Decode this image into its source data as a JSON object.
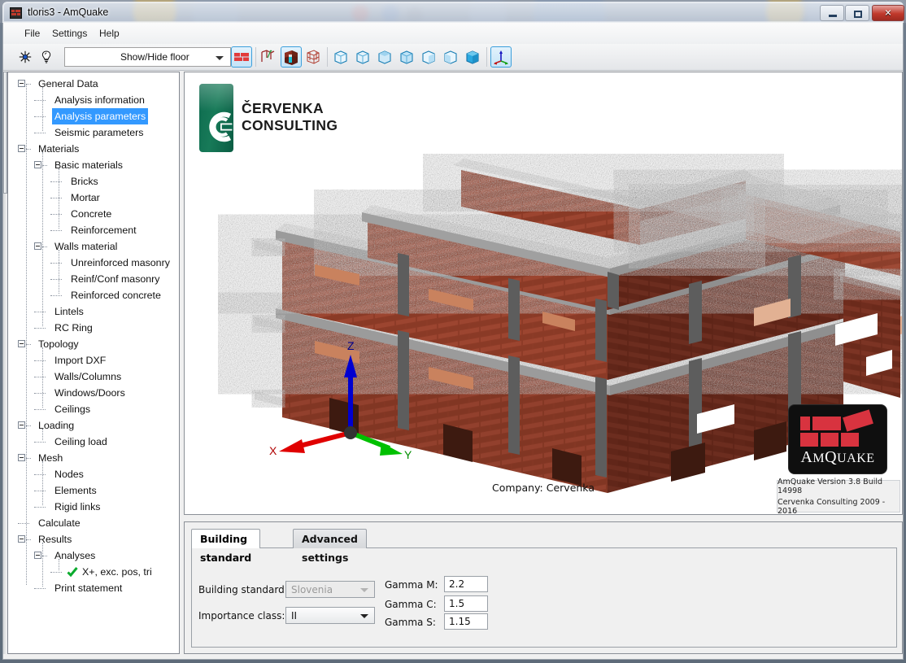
{
  "window": {
    "title": "tloris3 - AmQuake",
    "icon": "amquake-brick-icon",
    "minimize": "Minimize",
    "maximize": "Maximize",
    "close": "Close"
  },
  "menu": {
    "items": [
      {
        "label": "File",
        "name": "menu-file"
      },
      {
        "label": "Settings",
        "name": "menu-settings"
      },
      {
        "label": "Help",
        "name": "menu-help"
      }
    ]
  },
  "toolbar": {
    "sun_icon": "sun-light-icon",
    "bulb_icon": "lightbulb-icon",
    "floor_combo": {
      "value": "Show/Hide floor",
      "arrow": "chevron-down-icon"
    },
    "buttons": [
      {
        "name": "show-walls-button",
        "icon": "brick-wall-icon",
        "active": true
      },
      {
        "name": "show-graph-button",
        "icon": "graph-icon",
        "active": false
      },
      {
        "name": "show-solid-model-button",
        "icon": "solid-cube-icon",
        "active": true
      },
      {
        "name": "show-wireframe-button",
        "icon": "wireframe-cube-icon",
        "active": false
      },
      {
        "name": "view-front-button",
        "icon": "cube-view-1-icon",
        "active": false
      },
      {
        "name": "view-back-button",
        "icon": "cube-view-2-icon",
        "active": false
      },
      {
        "name": "view-top-button",
        "icon": "cube-view-3-icon",
        "active": false
      },
      {
        "name": "view-bottom-button",
        "icon": "cube-view-4-icon",
        "active": false
      },
      {
        "name": "view-left-button",
        "icon": "cube-view-5-icon",
        "active": false
      },
      {
        "name": "view-right-button",
        "icon": "cube-view-6-icon",
        "active": false
      },
      {
        "name": "view-iso-button",
        "icon": "cube-iso-filled-icon",
        "active": false
      },
      {
        "name": "axis-orientation-button",
        "icon": "axis-triad-icon",
        "active": false
      }
    ]
  },
  "tree": {
    "selected": "Analysis parameters",
    "items": [
      {
        "label": "General Data",
        "depth": 0,
        "expander": true,
        "name": "tree-item-general-data"
      },
      {
        "label": "Analysis information",
        "depth": 1,
        "expander": false,
        "name": "tree-item-analysis-information"
      },
      {
        "label": "Analysis parameters",
        "depth": 1,
        "expander": false,
        "name": "tree-item-analysis-parameters",
        "selected": true
      },
      {
        "label": "Seismic parameters",
        "depth": 1,
        "expander": false,
        "name": "tree-item-seismic-parameters"
      },
      {
        "label": "Materials",
        "depth": 0,
        "expander": true,
        "name": "tree-item-materials"
      },
      {
        "label": "Basic materials",
        "depth": 1,
        "expander": true,
        "name": "tree-item-basic-materials"
      },
      {
        "label": "Bricks",
        "depth": 2,
        "expander": false,
        "name": "tree-item-bricks"
      },
      {
        "label": "Mortar",
        "depth": 2,
        "expander": false,
        "name": "tree-item-mortar"
      },
      {
        "label": "Concrete",
        "depth": 2,
        "expander": false,
        "name": "tree-item-concrete"
      },
      {
        "label": "Reinforcement",
        "depth": 2,
        "expander": false,
        "name": "tree-item-reinforcement"
      },
      {
        "label": "Walls material",
        "depth": 1,
        "expander": true,
        "name": "tree-item-walls-material"
      },
      {
        "label": "Unreinforced masonry",
        "depth": 2,
        "expander": false,
        "name": "tree-item-unreinforced-masonry"
      },
      {
        "label": "Reinf/Conf masonry",
        "depth": 2,
        "expander": false,
        "name": "tree-item-reinf-conf-masonry"
      },
      {
        "label": "Reinforced concrete",
        "depth": 2,
        "expander": false,
        "name": "tree-item-reinforced-concrete"
      },
      {
        "label": "Lintels",
        "depth": 1,
        "expander": false,
        "name": "tree-item-lintels"
      },
      {
        "label": "RC Ring",
        "depth": 1,
        "expander": false,
        "name": "tree-item-rc-ring"
      },
      {
        "label": "Topology",
        "depth": 0,
        "expander": true,
        "name": "tree-item-topology"
      },
      {
        "label": "Import DXF",
        "depth": 1,
        "expander": false,
        "name": "tree-item-import-dxf"
      },
      {
        "label": "Walls/Columns",
        "depth": 1,
        "expander": false,
        "name": "tree-item-walls-columns"
      },
      {
        "label": "Windows/Doors",
        "depth": 1,
        "expander": false,
        "name": "tree-item-windows-doors"
      },
      {
        "label": "Ceilings",
        "depth": 1,
        "expander": false,
        "name": "tree-item-ceilings"
      },
      {
        "label": "Loading",
        "depth": 0,
        "expander": true,
        "name": "tree-item-loading"
      },
      {
        "label": "Ceiling load",
        "depth": 1,
        "expander": false,
        "name": "tree-item-ceiling-load"
      },
      {
        "label": "Mesh",
        "depth": 0,
        "expander": true,
        "name": "tree-item-mesh"
      },
      {
        "label": "Nodes",
        "depth": 1,
        "expander": false,
        "name": "tree-item-nodes"
      },
      {
        "label": "Elements",
        "depth": 1,
        "expander": false,
        "name": "tree-item-elements"
      },
      {
        "label": "Rigid links",
        "depth": 1,
        "expander": false,
        "name": "tree-item-rigid-links"
      },
      {
        "label": "Calculate",
        "depth": 0,
        "expander": false,
        "name": "tree-item-calculate"
      },
      {
        "label": "Results",
        "depth": 0,
        "expander": true,
        "name": "tree-item-results"
      },
      {
        "label": "Analyses",
        "depth": 1,
        "expander": true,
        "name": "tree-item-analyses"
      },
      {
        "label": "X+, exc. pos, tri",
        "depth": 2,
        "expander": false,
        "name": "tree-item-analysis-run",
        "check": true
      },
      {
        "label": "Print statement",
        "depth": 1,
        "expander": false,
        "name": "tree-item-print-statement"
      }
    ]
  },
  "viewport": {
    "logo": {
      "line1": "ČERVENKA",
      "line2": "CONSULTING",
      "mark": "cervenka-c-mark"
    },
    "axis": {
      "x": "X",
      "y": "Y",
      "z": "Z",
      "x_color": "#e00000",
      "y_color": "#00c000",
      "z_color": "#0000d0"
    },
    "company_label": "Company: Cervenka",
    "amquake_logo": {
      "word_am": "A",
      "word_m": "M",
      "word_q": "Q",
      "word_uake": "UAKE",
      "full": "AmQuake",
      "brick_color": "#d8333f",
      "bg_color": "#0f0f0f"
    },
    "version_box": {
      "line1": "AmQuake Version 3.8 Build 14998",
      "line2": "Cervenka Consulting 2009 - 2016"
    },
    "model": {
      "description": "3D masonry building model",
      "brick_color": "#8f3a28",
      "slab_color": "#b9b9b9",
      "column_color": "#6a6a6a"
    }
  },
  "bottom_panel": {
    "tabs": [
      {
        "label": "Building standard",
        "name": "tab-building-standard",
        "active": true
      },
      {
        "label": "Advanced settings",
        "name": "tab-advanced-settings",
        "active": false
      }
    ],
    "fields": {
      "building_standard_label": "Building standard:",
      "building_standard_value": "Slovenia",
      "importance_class_label": "Importance class:",
      "importance_class_value": "II",
      "gamma_m_label": "Gamma M:",
      "gamma_m_value": "2.2",
      "gamma_c_label": "Gamma C:",
      "gamma_c_value": "1.5",
      "gamma_s_label": "Gamma S:",
      "gamma_s_value": "1.15"
    }
  },
  "colors": {
    "selection_blue": "#3399ff",
    "accent_green": "#0e6b4f",
    "brand_red": "#d8333f"
  }
}
